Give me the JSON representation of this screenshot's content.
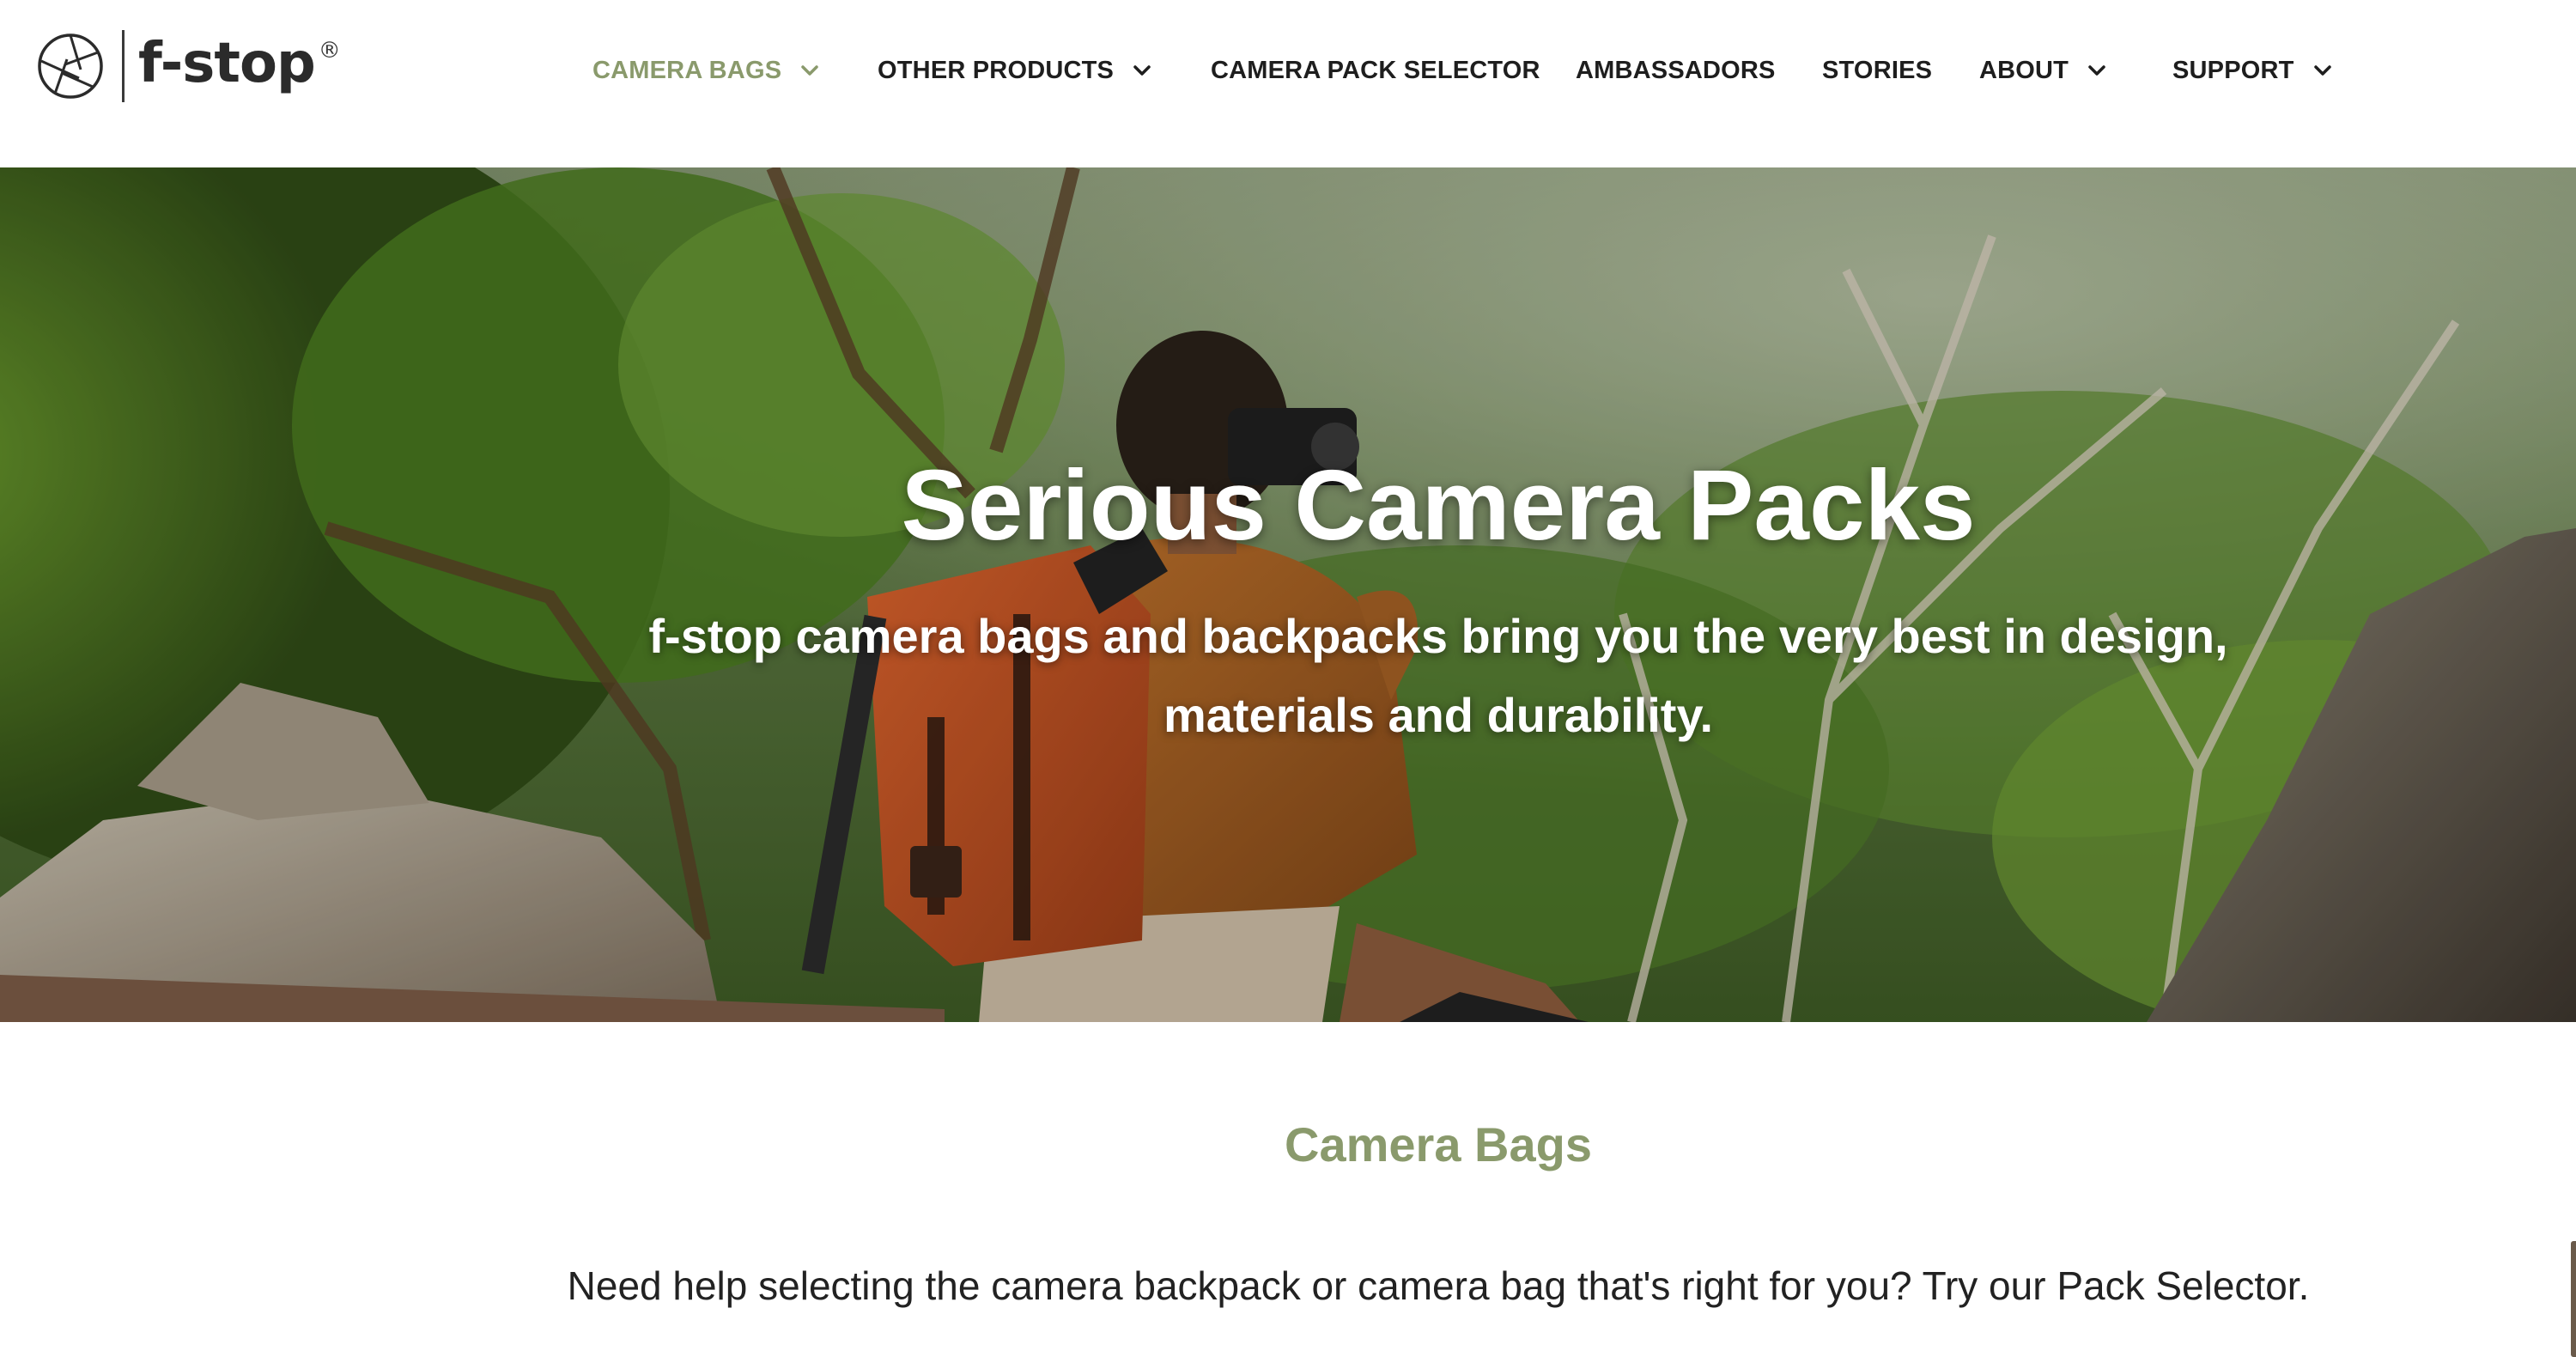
{
  "brand": {
    "name": "f-stop",
    "registered_mark": "®"
  },
  "nav": {
    "items": [
      {
        "label": "CAMERA BAGS",
        "has_dropdown": true,
        "active": true
      },
      {
        "label": "OTHER PRODUCTS",
        "has_dropdown": true,
        "active": false
      },
      {
        "label": "CAMERA PACK SELECTOR",
        "has_dropdown": false,
        "active": false
      },
      {
        "label": "AMBASSADORS",
        "has_dropdown": false,
        "active": false
      },
      {
        "label": "STORIES",
        "has_dropdown": false,
        "active": false
      },
      {
        "label": "ABOUT",
        "has_dropdown": true,
        "active": false
      },
      {
        "label": "SUPPORT",
        "has_dropdown": true,
        "active": false
      }
    ]
  },
  "hero": {
    "title": "Serious Camera Packs",
    "subtitle": "f-stop camera bags and backpacks bring you the very best in design, materials and durability."
  },
  "main": {
    "section_title": "Camera Bags",
    "intro": "Need help selecting the camera backpack or camera bag that's right for you? Try our Pack Selector."
  },
  "colors": {
    "accent": "#8a9a6c",
    "text": "#1e1e1e",
    "background": "#ffffff"
  }
}
